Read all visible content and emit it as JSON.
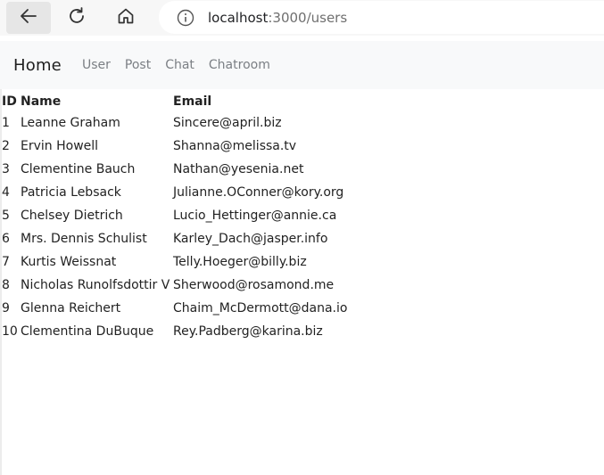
{
  "browser": {
    "url_host": "localhost",
    "url_rest": ":3000/users"
  },
  "nav": {
    "brand": "Home",
    "links": [
      "User",
      "Post",
      "Chat",
      "Chatroom"
    ]
  },
  "table": {
    "headers": [
      "ID",
      "Name",
      "Email"
    ],
    "rows": [
      {
        "id": "1",
        "name": "Leanne Graham",
        "email": "Sincere@april.biz"
      },
      {
        "id": "2",
        "name": "Ervin Howell",
        "email": "Shanna@melissa.tv"
      },
      {
        "id": "3",
        "name": "Clementine Bauch",
        "email": "Nathan@yesenia.net"
      },
      {
        "id": "4",
        "name": "Patricia Lebsack",
        "email": "Julianne.OConner@kory.org"
      },
      {
        "id": "5",
        "name": "Chelsey Dietrich",
        "email": "Lucio_Hettinger@annie.ca"
      },
      {
        "id": "6",
        "name": "Mrs. Dennis Schulist",
        "email": "Karley_Dach@jasper.info"
      },
      {
        "id": "7",
        "name": "Kurtis Weissnat",
        "email": "Telly.Hoeger@billy.biz"
      },
      {
        "id": "8",
        "name": "Nicholas Runolfsdottir V",
        "email": "Sherwood@rosamond.me"
      },
      {
        "id": "9",
        "name": "Glenna Reichert",
        "email": "Chaim_McDermott@dana.io"
      },
      {
        "id": "10",
        "name": "Clementina DuBuque",
        "email": "Rey.Padberg@karina.biz"
      }
    ]
  }
}
